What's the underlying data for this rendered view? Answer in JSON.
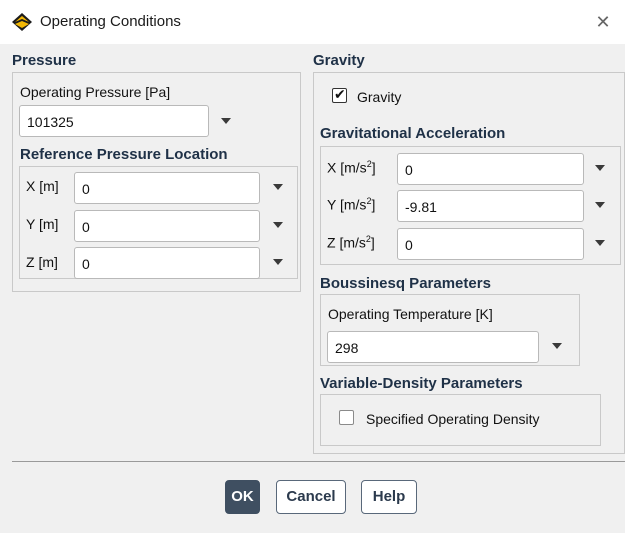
{
  "window": {
    "title": "Operating Conditions",
    "close_glyph": "✕"
  },
  "pressure": {
    "heading": "Pressure",
    "operating_pressure_label": "Operating Pressure [Pa]",
    "operating_pressure_value": "101325",
    "reference_location_heading": "Reference Pressure Location",
    "x_label": "X [m]",
    "x_value": "0",
    "y_label": "Y [m]",
    "y_value": "0",
    "z_label": "Z [m]",
    "z_value": "0"
  },
  "gravity": {
    "heading": "Gravity",
    "checkbox_label": "Gravity",
    "checked": true,
    "acceleration_heading": "Gravitational Acceleration",
    "unit_prefix": "[m/s",
    "unit_exp": "2",
    "unit_suffix": "]",
    "x_label": "X",
    "x_value": "0",
    "y_label": "Y",
    "y_value": "-9.81",
    "z_label": "Z",
    "z_value": "0"
  },
  "boussinesq": {
    "heading": "Boussinesq Parameters",
    "temperature_label": "Operating Temperature [K]",
    "temperature_value": "298"
  },
  "variable_density": {
    "heading": "Variable-Density Parameters",
    "checkbox_label": "Specified Operating Density",
    "checked": false
  },
  "buttons": {
    "ok": "OK",
    "cancel": "Cancel",
    "help": "Help"
  },
  "colors": {
    "heading": "#1f3147",
    "ok_button": "#3f4f61",
    "background": "#f0f0f0"
  }
}
